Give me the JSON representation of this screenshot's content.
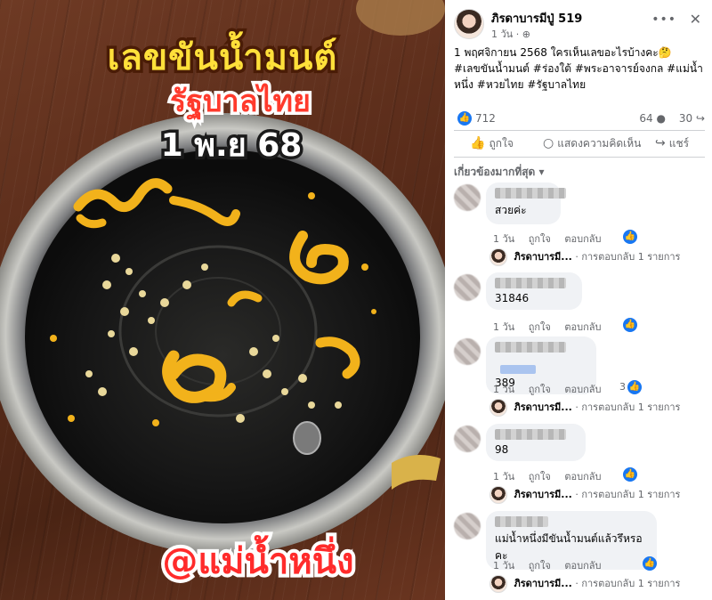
{
  "image": {
    "title_line1": "เลขขันน้ำมนต์",
    "title_line2": "รัฐบาลไทย",
    "title_line3": "1 พ.ย 68",
    "handle": "@แม่น้ำหนึ่ง"
  },
  "post": {
    "author": "ภิรดาบารมีปู่ 519",
    "time": "1 วัน",
    "privacy_icon": "globe-icon",
    "caption": "1 พฤศจิกายน 2568 ใครเห็นเลขอะไรบ้างคะ🤔",
    "hashtags": "#เลขขันน้ำมนต์ #ร่องใต้ #พระอาจารย์จงกล #แม่น้ำหนึ่ง #หวยไทย #รัฐบาลไทย",
    "likes": "712",
    "comments": "64",
    "shares": "30",
    "actions": {
      "like": "ถูกใจ",
      "comment": "แสดงความคิดเห็น",
      "share": "แชร์"
    },
    "filter_label": "เกี่ยวข้องมากที่สุด"
  },
  "comments": [
    {
      "text": "สวยค่ะ",
      "time": "1 วัน",
      "like": "ถูกใจ",
      "reply": "ตอบกลับ",
      "reaction_count": "",
      "reply_author": "ภิรดาบารมี...",
      "reply_summary": "· การตอบกลับ 1 รายการ"
    },
    {
      "text": "31846",
      "time": "1 วัน",
      "like": "ถูกใจ",
      "reply": "ตอบกลับ",
      "reaction_count": "",
      "reply_author": "",
      "reply_summary": ""
    },
    {
      "text": "389",
      "time": "1 วัน",
      "like": "ถูกใจ",
      "reply": "ตอบกลับ",
      "reaction_count": "3",
      "reply_author": "ภิรดาบารมี...",
      "reply_summary": "· การตอบกลับ 1 รายการ"
    },
    {
      "text": "98",
      "time": "1 วัน",
      "like": "ถูกใจ",
      "reply": "ตอบกลับ",
      "reaction_count": "",
      "reply_author": "ภิรดาบารมี...",
      "reply_summary": "· การตอบกลับ 1 รายการ"
    },
    {
      "text": "แม่น้ำหนึ่งมีขันน้ำมนต์แล้วรึหรอคะ",
      "time": "1 วัน",
      "like": "ถูกใจ",
      "reply": "ตอบกลับ",
      "reaction_count": "",
      "reply_author": "ภิรดาบารมี...",
      "reply_summary": "· การตอบกลับ 1 รายการ"
    }
  ],
  "colors": {
    "accent": "#1877f2",
    "muted": "#65676b",
    "bubble": "#f0f2f5"
  }
}
